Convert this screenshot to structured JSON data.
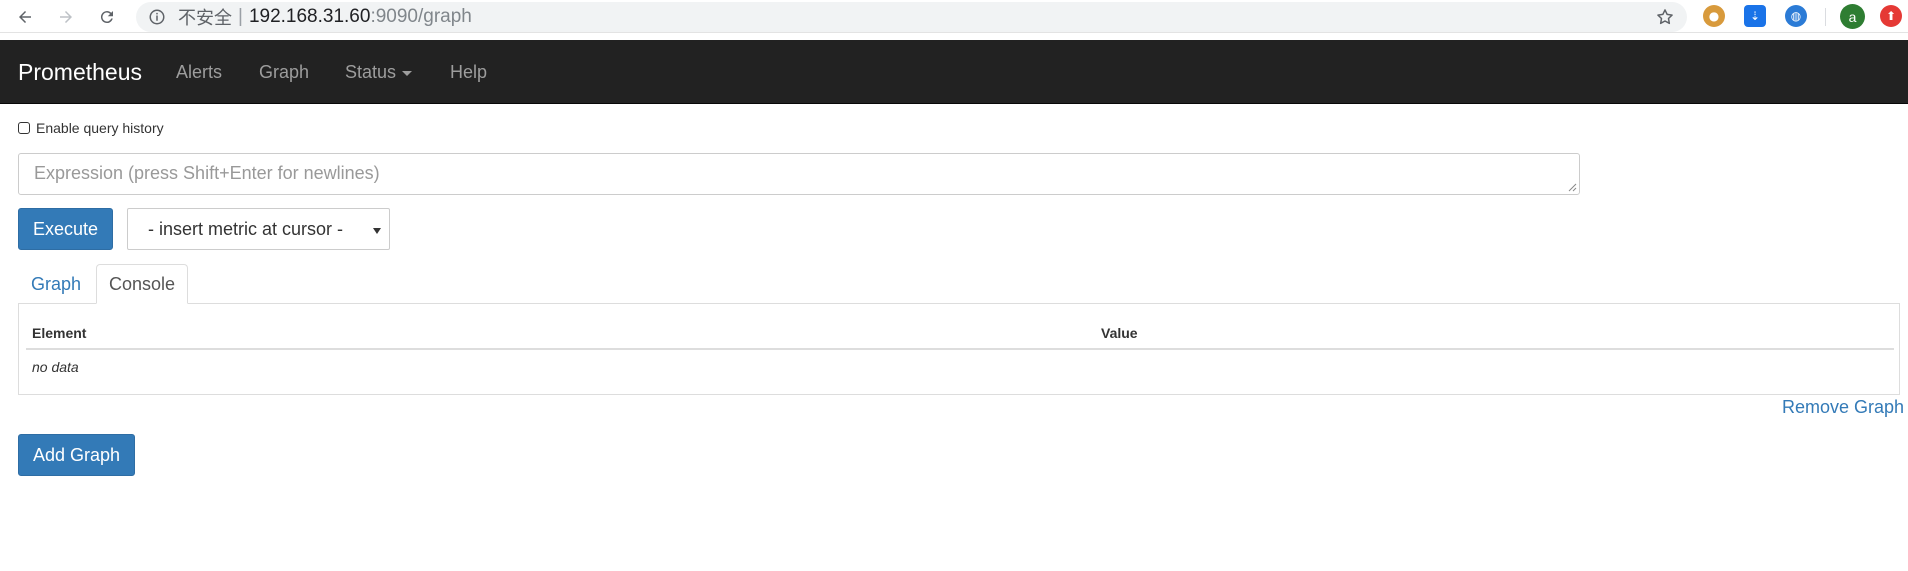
{
  "browser": {
    "security_label": "不安全",
    "separator": "|",
    "url_host": "192.168.31.60",
    "url_rest": ":9090/graph",
    "profile_initial": "a"
  },
  "navbar": {
    "brand": "Prometheus",
    "links": [
      "Alerts",
      "Graph",
      "Status",
      "Help"
    ]
  },
  "history": {
    "label": "Enable query history",
    "checked": false
  },
  "expression": {
    "placeholder": "Expression (press Shift+Enter for newlines)",
    "value": ""
  },
  "controls": {
    "execute_label": "Execute",
    "metric_select_value": "- insert metric at cursor -"
  },
  "tabs": {
    "graph": "Graph",
    "console": "Console",
    "active": "Console"
  },
  "console": {
    "columns": [
      "Element",
      "Value"
    ],
    "empty_text": "no data"
  },
  "actions": {
    "remove_graph": "Remove Graph",
    "add_graph": "Add Graph"
  },
  "colors": {
    "navbar_bg": "#222222",
    "primary": "#337ab7",
    "link": "#337ab7"
  }
}
